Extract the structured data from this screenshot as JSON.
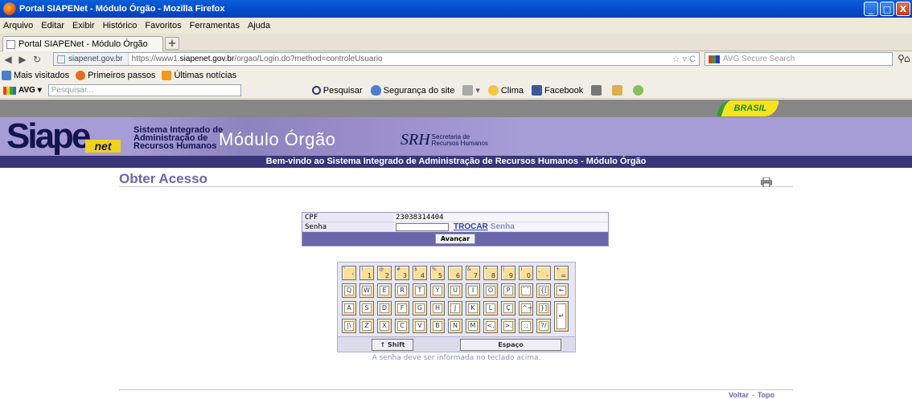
{
  "window": {
    "title": "Portal SIAPENet - Módulo Órgão - Mozilla Firefox",
    "buttons": [
      "_",
      "□",
      "X"
    ]
  },
  "menu": [
    "Arquivo",
    "Editar",
    "Exibir",
    "Histórico",
    "Favoritos",
    "Ferramentas",
    "Ajuda"
  ],
  "tab": {
    "title": "Portal SIAPENet - Módulo Órgão",
    "new_tab": "+"
  },
  "nav": {
    "site_label": "siapenet.gov.br",
    "url_prefix": "https://www1.",
    "url_domain": "siapenet.gov.br",
    "url_path": "/orgao/Login.do?method=controleUsuario",
    "search_placeholder": "AVG Secure Search",
    "stars": "☆ ▿ C"
  },
  "bookmarks": [
    "Mais visitados",
    "Primeiros passos",
    "Últimas notícias"
  ],
  "avg": {
    "logo": "AVG ▾",
    "search_placeholder": "Pesquisar...",
    "items": [
      "Pesquisar",
      "Segurança do site",
      "Clima",
      "Facebook"
    ]
  },
  "brasil": "BRASIL",
  "banner": {
    "logo_main": "Siape",
    "logo_net": "net",
    "system_line1": "Sistema Integrado de",
    "system_line2": "Administração de",
    "system_line3": "Recursos Humanos",
    "module": "Módulo Órgão",
    "srh_logo": "SRH",
    "srh_line1": "Secretaria de",
    "srh_line2": "Recursos Humanos"
  },
  "welcome": "Bem-vindo ao Sistema Integrado de Administração de Recursos Humanos - Módulo Órgão",
  "page_title": "Obter Acesso",
  "form": {
    "cpf_label": "CPF",
    "cpf_value": "23038314404",
    "senha_label": "Senha",
    "trocar": "TROCAR",
    "trocar_suffix": "Senha",
    "submit": "Avançar"
  },
  "keyboard": {
    "row1": [
      {
        "sm": "\"",
        "lg": "'"
      },
      {
        "sm": "!",
        "lg": "1"
      },
      {
        "sm": "@",
        "lg": "2"
      },
      {
        "sm": "#",
        "lg": "3"
      },
      {
        "sm": "$",
        "lg": "4"
      },
      {
        "sm": "%",
        "lg": "5"
      },
      {
        "sm": "¨",
        "lg": "6"
      },
      {
        "sm": "&",
        "lg": "7"
      },
      {
        "sm": "*",
        "lg": "8"
      },
      {
        "sm": "(",
        "lg": "9"
      },
      {
        "sm": ")",
        "lg": "0"
      },
      {
        "sm": "_",
        "lg": "-"
      },
      {
        "sm": "+",
        "lg": "="
      }
    ],
    "row2": [
      "Q",
      "W",
      "E",
      "R",
      "T",
      "Y",
      "U",
      "I",
      "O",
      "P",
      "`´",
      "{["
    ],
    "row3": [
      "A",
      "S",
      "D",
      "F",
      "G",
      "H",
      "J",
      "K",
      "L",
      "Ç",
      "^~",
      "}]"
    ],
    "row4": [
      "|\\",
      "Z",
      "X",
      "C",
      "V",
      "B",
      "N",
      "M",
      "<,",
      ">.",
      ":;",
      "?/"
    ],
    "backspace": "←",
    "enter": "↵",
    "shift": "↑ Shift",
    "space": "Espaço"
  },
  "hint": "A senha deve ser informada no teclado acima.",
  "footer": {
    "voltar": "Voltar",
    "sep": "-",
    "topo": "Topo"
  }
}
